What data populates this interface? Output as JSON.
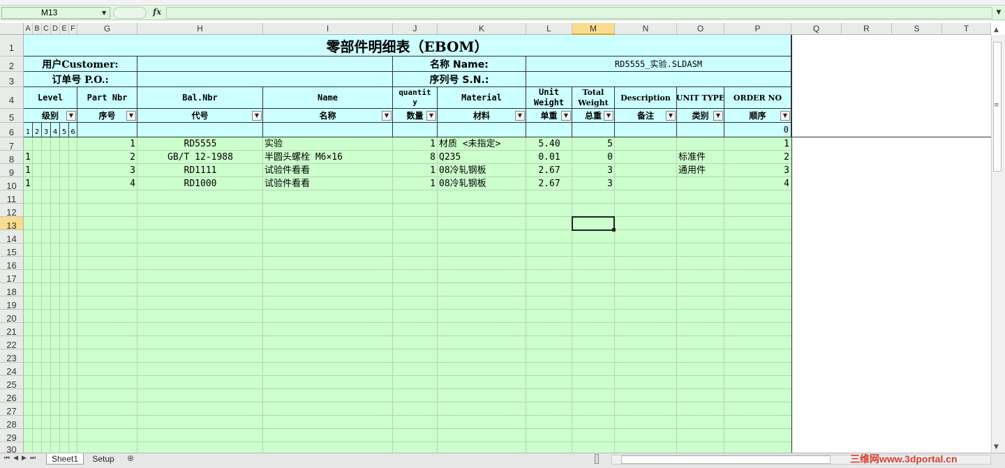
{
  "formula_bar": {
    "name_box": "M13",
    "fx": "fx",
    "formula": ""
  },
  "columns": [
    "A",
    "B",
    "C",
    "D",
    "E",
    "F",
    "G",
    "H",
    "I",
    "J",
    "K",
    "L",
    "M",
    "N",
    "O",
    "P",
    "Q",
    "R",
    "S",
    "T"
  ],
  "rows": [
    "1",
    "2",
    "3",
    "4",
    "5",
    "6",
    "7",
    "8",
    "9",
    "10",
    "11",
    "12",
    "13",
    "14",
    "15",
    "16",
    "17",
    "18",
    "19",
    "20",
    "21",
    "22",
    "23",
    "24",
    "25",
    "26",
    "27",
    "28",
    "29",
    "30"
  ],
  "header": {
    "title": "零部件明细表（EBOM）",
    "customer_label": "用户Customer:",
    "name_label": "名称 Name:",
    "name_value": "RD5555_实验.SLDASM",
    "po_label": "订单号 P.O.:",
    "sn_label": "序列号 S.N.:",
    "cols_en": {
      "level": "Level",
      "part_nbr": "Part Nbr",
      "bal_nbr": "Bal.Nbr",
      "name": "Name",
      "quantity_1": "quantit",
      "quantity_2": "y",
      "material": "Material",
      "unit_weight_1": "Unit",
      "unit_weight_2": "Weight",
      "total_weight_1": "Total",
      "total_weight_2": "Weight",
      "description": "Description",
      "unit_type": "UNIT TYPE",
      "order_no": "ORDER NO"
    },
    "cols_cn": {
      "level": "级别",
      "part_nbr": "序号",
      "bal_nbr": "代号",
      "name": "名称",
      "quantity": "数量",
      "material": "材料",
      "unit_weight": "单重",
      "total_weight": "总重",
      "description": "备注",
      "unit_type": "类别",
      "order_no": "顺序"
    },
    "level_digits": [
      "1",
      "2",
      "3",
      "4",
      "5",
      "6"
    ],
    "order_zero": "0"
  },
  "data_rows": [
    {
      "level": "",
      "part_nbr": "1",
      "bal_nbr": "RD5555",
      "name": "实验",
      "qty": "1",
      "material": "材质 <未指定>",
      "unit_weight": "5.40",
      "total_weight": "5",
      "description": "",
      "unit_type": "",
      "order": "1"
    },
    {
      "level": "1",
      "part_nbr": "2",
      "bal_nbr": "GB/T 12-1988",
      "name": "半圆头螺栓 M6×16",
      "qty": "8",
      "material": "Q235",
      "unit_weight": "0.01",
      "total_weight": "0",
      "description": "",
      "unit_type": "标准件",
      "order": "2"
    },
    {
      "level": "1",
      "part_nbr": "3",
      "bal_nbr": "RD1111",
      "name": "试验件看看",
      "qty": "1",
      "material": "08冷轧钢板",
      "unit_weight": "2.67",
      "total_weight": "3",
      "description": "",
      "unit_type": "通用件",
      "order": "3"
    },
    {
      "level": "1",
      "part_nbr": "4",
      "bal_nbr": "RD1000",
      "name": "试验件看看",
      "qty": "1",
      "material": "08冷轧钢板",
      "unit_weight": "2.67",
      "total_weight": "3",
      "description": "",
      "unit_type": "",
      "order": "4"
    }
  ],
  "sheets": [
    "Sheet1",
    "Setup"
  ],
  "watermark": "三维网www.3dportal.cn",
  "colors": {
    "grid_green": "#ccffcc",
    "header_cyan": "#ccffff",
    "selection_orange": "#f9dc8f"
  }
}
